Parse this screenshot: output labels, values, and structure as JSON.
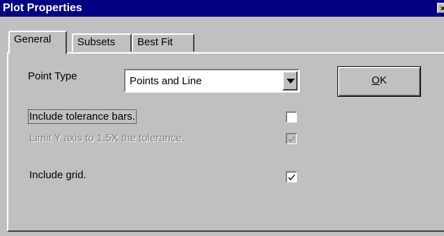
{
  "window": {
    "title": "Plot Properties",
    "close_glyph": "×"
  },
  "tabs": [
    {
      "label": "General",
      "active": true
    },
    {
      "label": "Subsets",
      "active": false
    },
    {
      "label": "Best Fit",
      "active": false
    }
  ],
  "general": {
    "point_type_label": "Point Type",
    "point_type_value": "Points and Line",
    "include_tolerance_label": "Include tolerance bars.",
    "include_tolerance_checked": false,
    "limit_y_label": "Limit Y axis to 1.5X the tolerance.",
    "limit_y_checked": true,
    "limit_y_enabled": false,
    "include_grid_label": "Include  grid.",
    "include_grid_checked": true
  },
  "buttons": {
    "ok_label_underlined": "O",
    "ok_label_rest": "K"
  }
}
